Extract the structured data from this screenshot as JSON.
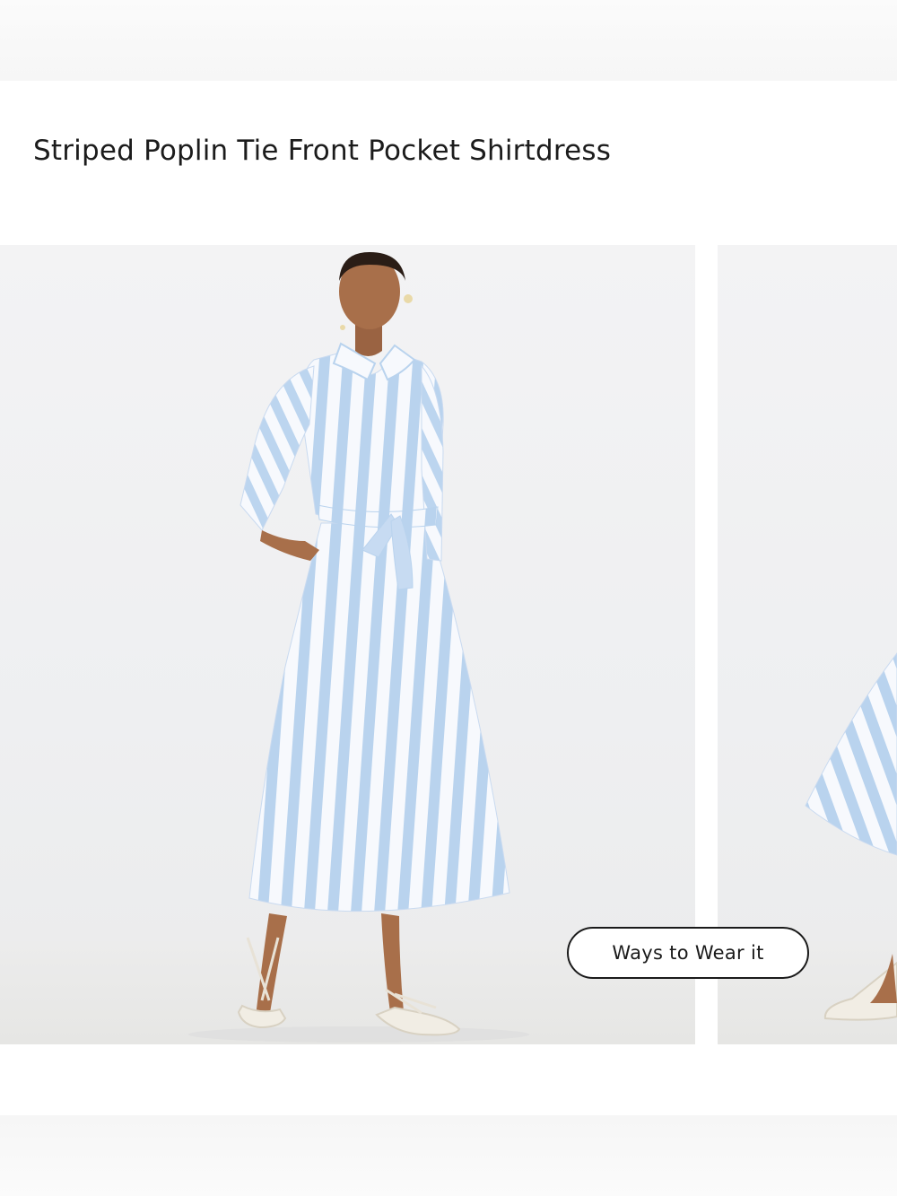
{
  "product": {
    "title": "Striped Poplin Tie Front Pocket Shirtdress"
  },
  "gallery": {
    "ways_to_wear_label": "Ways to Wear it",
    "colors": {
      "stripe_blue": "#b9d3ee",
      "stripe_white": "#f7f9fd",
      "background": "#efeff1",
      "skin": "#a86f4a"
    }
  }
}
